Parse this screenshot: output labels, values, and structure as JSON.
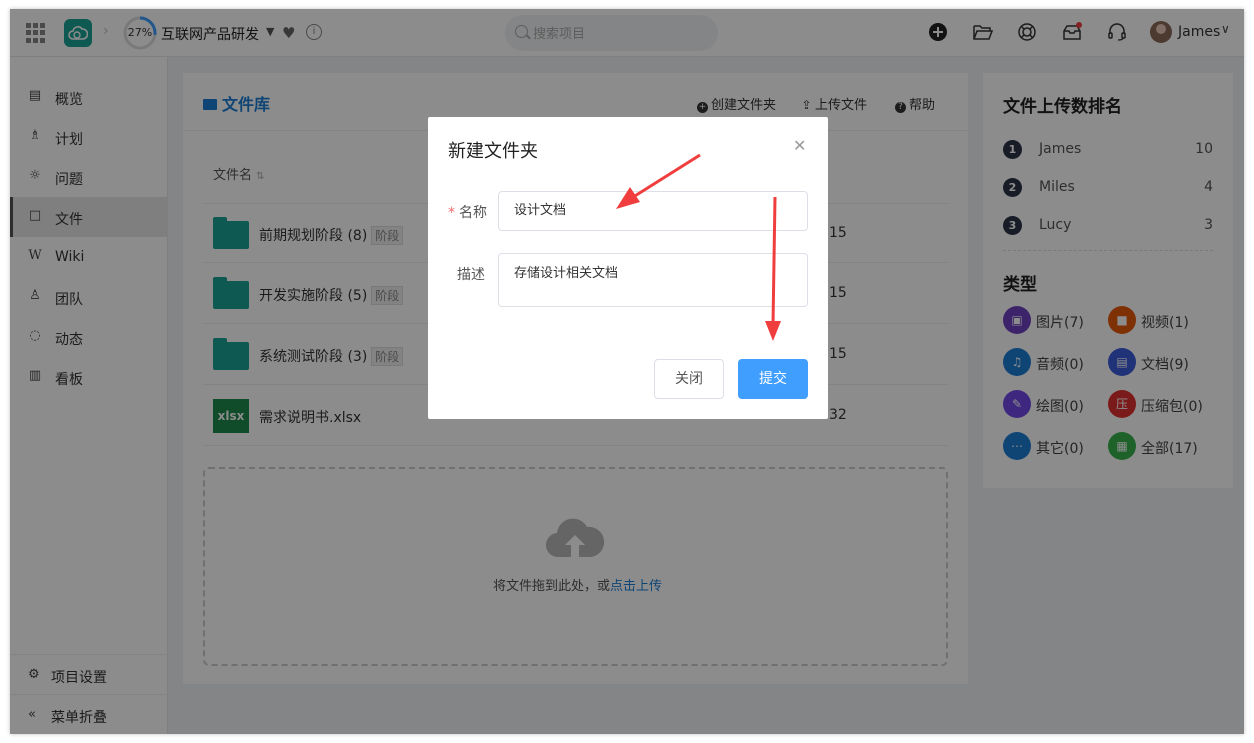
{
  "header": {
    "progress_text": "27%",
    "progress_value": 0.27,
    "project_name": "互联网产品研发",
    "info_glyph": "i",
    "search_placeholder": "搜索项目",
    "user_name": "James"
  },
  "sidebar": {
    "items": [
      {
        "label": "概览",
        "icon": "overview-icon"
      },
      {
        "label": "计划",
        "icon": "plan-icon"
      },
      {
        "label": "问题",
        "icon": "bug-icon"
      },
      {
        "label": "文件",
        "icon": "folder-icon"
      },
      {
        "label": "Wiki",
        "icon": "wiki-icon"
      },
      {
        "label": "团队",
        "icon": "team-icon"
      },
      {
        "label": "动态",
        "icon": "activity-icon"
      },
      {
        "label": "看板",
        "icon": "board-icon"
      }
    ],
    "active_index": 3,
    "settings_label": "项目设置",
    "collapse_label": "菜单折叠"
  },
  "file_library": {
    "title": "文件库",
    "actions": {
      "create_folder": "创建文件夹",
      "upload": "上传文件",
      "help": "帮助"
    },
    "column_name": "文件名",
    "rows": [
      {
        "name": "前期规划阶段 (8)",
        "tag": "阶段",
        "date_tail": "15",
        "kind": "folder"
      },
      {
        "name": "开发实施阶段 (5)",
        "tag": "阶段",
        "date_tail": "15",
        "kind": "folder"
      },
      {
        "name": "系统测试阶段 (3)",
        "tag": "阶段",
        "date_tail": "15",
        "kind": "folder"
      },
      {
        "name": "需求说明书.xlsx",
        "tag": "",
        "date_tail": "32",
        "kind": "xlsx",
        "icon_text": "xlsx"
      }
    ],
    "drop_text": "将文件拖到此处，或",
    "drop_link": "点击上传"
  },
  "rank": {
    "title": "文件上传数排名",
    "items": [
      {
        "num": "1",
        "name": "James",
        "count": "10"
      },
      {
        "num": "2",
        "name": "Miles",
        "count": "4"
      },
      {
        "num": "3",
        "name": "Lucy",
        "count": "3"
      }
    ]
  },
  "types": {
    "title": "类型",
    "items": [
      {
        "label": "图片(7)",
        "color": "#6f42c1",
        "icon": "image-icon",
        "glyph": "▣"
      },
      {
        "label": "视频(1)",
        "color": "#e8590c",
        "icon": "video-icon",
        "glyph": "■"
      },
      {
        "label": "音频(0)",
        "color": "#1c7ed6",
        "icon": "audio-icon",
        "glyph": "♫"
      },
      {
        "label": "文档(9)",
        "color": "#3b5bdb",
        "icon": "document-icon",
        "glyph": "▤"
      },
      {
        "label": "绘图(0)",
        "color": "#7048e8",
        "icon": "drawing-icon",
        "glyph": "✎"
      },
      {
        "label": "压缩包(0)",
        "color": "#e03131",
        "icon": "archive-icon",
        "glyph": "压"
      },
      {
        "label": "其它(0)",
        "color": "#1c7ed6",
        "icon": "other-icon",
        "glyph": "⋯"
      },
      {
        "label": "全部(17)",
        "color": "#37b24d",
        "icon": "all-icon",
        "glyph": "▦"
      }
    ]
  },
  "dialog": {
    "title": "新建文件夹",
    "name_label": "名称",
    "name_value": "设计文档",
    "desc_label": "描述",
    "desc_value": "存储设计相关文档",
    "close_label": "关闭",
    "submit_label": "提交"
  },
  "colors": {
    "accent": "#1aa394",
    "primary": "#409eff",
    "link": "#1c7ed6",
    "annotation_arrow": "#f03e3e"
  }
}
